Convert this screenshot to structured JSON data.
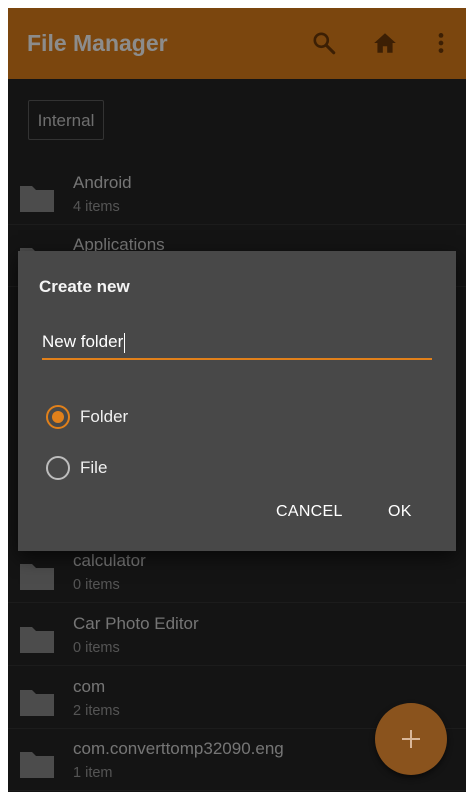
{
  "app_bar": {
    "title": "File Manager",
    "color": "#e1801a",
    "icons": [
      "search-icon",
      "home-icon",
      "more-vert-icon"
    ]
  },
  "location": {
    "label": "Internal"
  },
  "files": [
    {
      "name": "Android",
      "count": "4 items"
    },
    {
      "name": "Applications",
      "count": ""
    },
    {
      "name": "calculator",
      "count": "0 items"
    },
    {
      "name": "Car Photo Editor",
      "count": "0 items"
    },
    {
      "name": "com",
      "count": "2 items"
    },
    {
      "name": "com.converttomp32090.eng",
      "count": "1 item"
    }
  ],
  "dialog": {
    "title": "Create new",
    "name_input": {
      "value": "New folder"
    },
    "options": [
      {
        "label": "Folder",
        "selected": true
      },
      {
        "label": "File",
        "selected": false
      }
    ],
    "cancel_label": "CANCEL",
    "ok_label": "OK"
  },
  "fab": {
    "icon": "plus-icon"
  }
}
